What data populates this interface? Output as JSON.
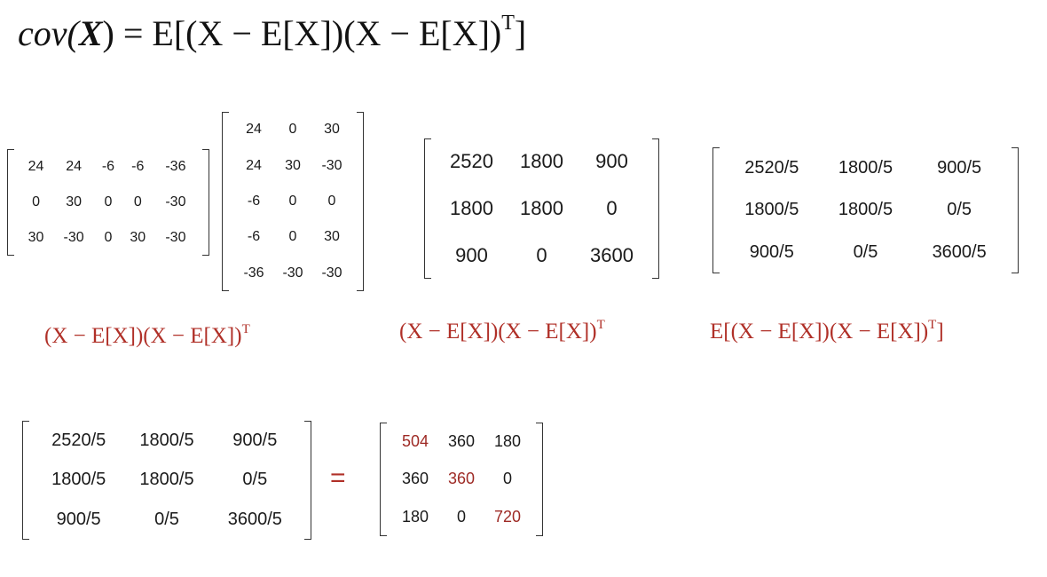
{
  "title": {
    "lhs": "cov(",
    "lhs_var": "X",
    "lhs_close": ")",
    "rhs": "= E[(X  − E[X])(X  − E[X])",
    "sup": "T",
    "rhs_close": "]"
  },
  "captions": {
    "c1": "(X  − E[X])(X  − E[X])",
    "c1_sup": "T",
    "c2": "(X  − E[X])(X  − E[X])",
    "c2_sup": "T",
    "c3": "E[(X  − E[X])(X  − E[X])",
    "c3_sup": "T",
    "c3_close": "]"
  },
  "equals_sign": "=",
  "matrices": {
    "centered": [
      [
        "24",
        "24",
        "-6",
        "-6",
        "-36"
      ],
      [
        "0",
        "30",
        "0",
        "0",
        "-30"
      ],
      [
        "30",
        "-30",
        "0",
        "30",
        "-30"
      ]
    ],
    "centered_transpose": [
      [
        "24",
        "0",
        "30"
      ],
      [
        "24",
        "30",
        "-30"
      ],
      [
        "-6",
        "0",
        "0"
      ],
      [
        "-6",
        "0",
        "30"
      ],
      [
        "-36",
        "-30",
        "-30"
      ]
    ],
    "product": [
      [
        "2520",
        "1800",
        "900"
      ],
      [
        "1800",
        "1800",
        "0"
      ],
      [
        "900",
        "0",
        "3600"
      ]
    ],
    "divided": [
      [
        "2520/5",
        "1800/5",
        "900/5"
      ],
      [
        "1800/5",
        "1800/5",
        "0/5"
      ],
      [
        "900/5",
        "0/5",
        "3600/5"
      ]
    ],
    "divided_repeat": [
      [
        "2520/5",
        "1800/5",
        "900/5"
      ],
      [
        "1800/5",
        "1800/5",
        "0/5"
      ],
      [
        "900/5",
        "0/5",
        "3600/5"
      ]
    ],
    "result": [
      [
        "504",
        "360",
        "180"
      ],
      [
        "360",
        "360",
        "0"
      ],
      [
        "180",
        "0",
        "720"
      ]
    ]
  },
  "highlight_color": "#9e2a25",
  "caption_color": "#b03028"
}
